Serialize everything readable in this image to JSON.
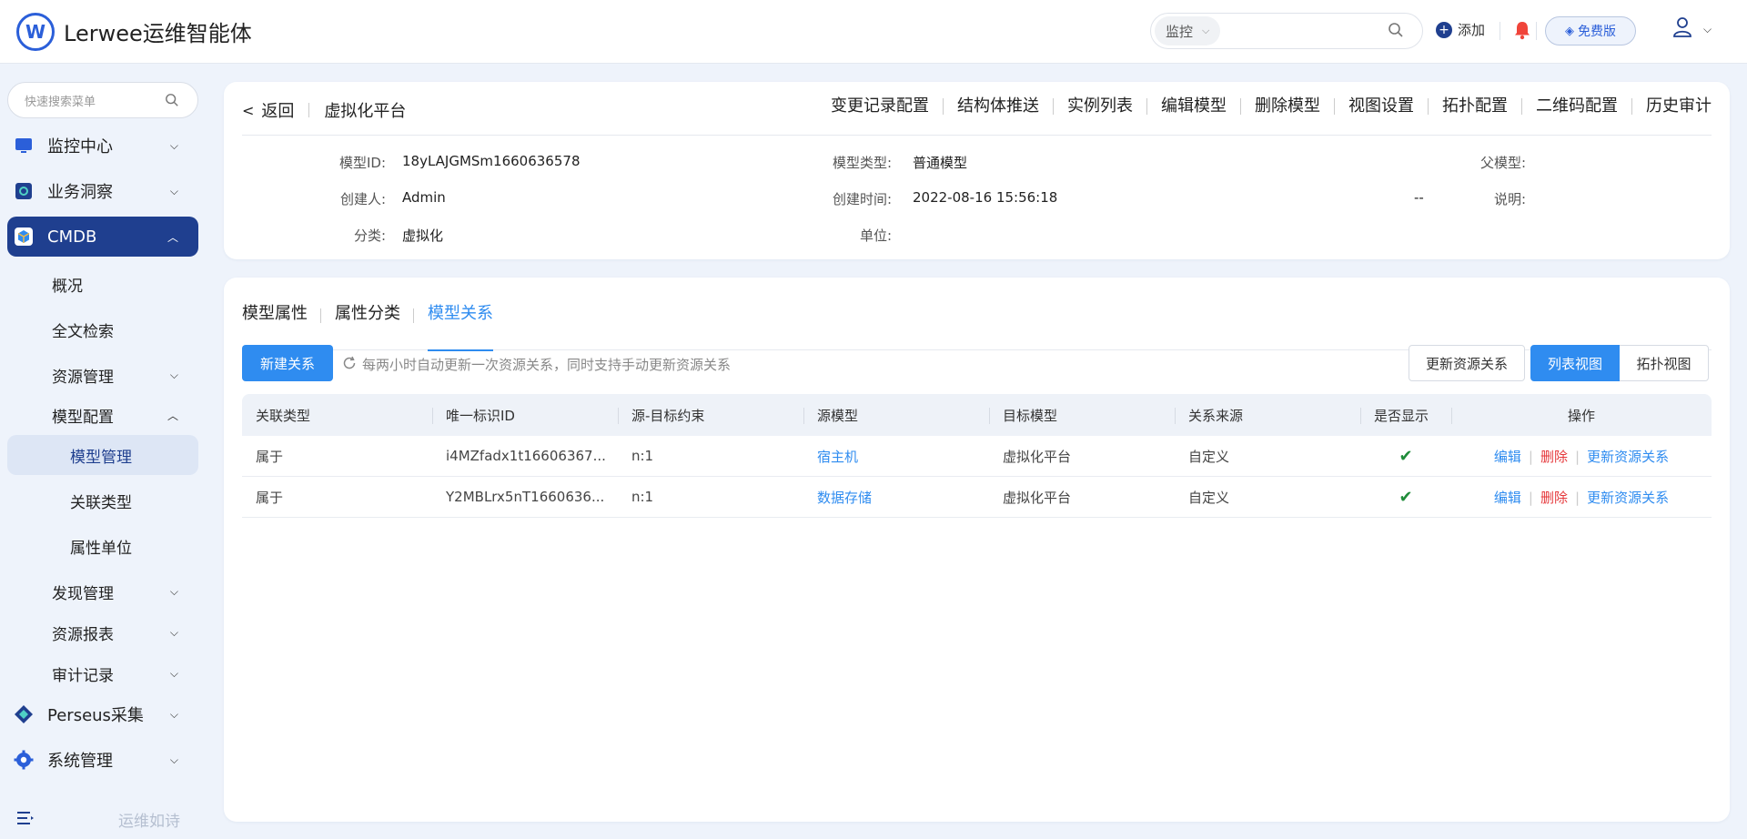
{
  "app": {
    "title": "Lerwee运维智能体",
    "logo_letter": "W"
  },
  "header": {
    "search_scope": "监控",
    "add_label": "添加",
    "free_label": "免费版",
    "icons": [
      "search-icon",
      "plus-circle-icon",
      "bell-icon",
      "diamond-icon",
      "user-icon",
      "chevron-down-icon"
    ]
  },
  "sidebar": {
    "search_placeholder": "快速搜索菜单",
    "items": [
      {
        "label": "监控中心",
        "icon": "monitor-icon"
      },
      {
        "label": "业务洞察",
        "icon": "insight-icon"
      },
      {
        "label": "CMDB",
        "icon": "cube-icon",
        "active": true
      },
      {
        "label": "Perseus采集",
        "icon": "perseus-icon"
      },
      {
        "label": "系统管理",
        "icon": "gear-icon"
      }
    ],
    "sub_items": [
      {
        "label": "概况"
      },
      {
        "label": "全文检索"
      },
      {
        "label": "资源管理"
      },
      {
        "label": "模型配置"
      },
      {
        "label": "模型管理",
        "selected": true
      },
      {
        "label": "关联类型"
      },
      {
        "label": "属性单位"
      },
      {
        "label": "发现管理"
      },
      {
        "label": "资源报表"
      },
      {
        "label": "审计记录"
      }
    ],
    "footer_slogan": "运维如诗"
  },
  "detail": {
    "back_label": "返回",
    "model_name": "虚拟化平台",
    "actions": [
      "变更记录配置",
      "结构体推送",
      "实例列表",
      "编辑模型",
      "删除模型",
      "视图设置",
      "拓扑配置",
      "二维码配置",
      "历史审计"
    ],
    "fields": {
      "model_id_label": "模型ID:",
      "model_id": "18yLAJGMSm1660636578",
      "model_type_label": "模型类型:",
      "model_type": "普通模型",
      "parent_label": "父模型:",
      "parent": "",
      "creator_label": "创建人:",
      "creator": "Admin",
      "created_label": "创建时间:",
      "created": "2022-08-16 15:56:18",
      "desc_label": "说明:",
      "desc": "--",
      "category_label": "分类:",
      "category": "虚拟化",
      "unit_label": "单位:",
      "unit": ""
    }
  },
  "relations": {
    "tabs": [
      "模型属性",
      "属性分类",
      "模型关系"
    ],
    "active_tab": 2,
    "new_button": "新建关系",
    "tip": "每两小时自动更新一次资源关系，同时支持手动更新资源关系",
    "update_button": "更新资源关系",
    "view_list": "列表视图",
    "view_topo": "拓扑视图",
    "columns": [
      "关联类型",
      "唯一标识ID",
      "源-目标约束",
      "源模型",
      "目标模型",
      "关系来源",
      "是否显示",
      "操作"
    ],
    "rows": [
      {
        "type": "属于",
        "uid": "i4MZfadx1t16606367...",
        "constraint": "n:1",
        "source": "宿主机",
        "target": "虚拟化平台",
        "origin": "自定义",
        "shown": true
      },
      {
        "type": "属于",
        "uid": "Y2MBLrx5nT1660636...",
        "constraint": "n:1",
        "source": "数据存储",
        "target": "虚拟化平台",
        "origin": "自定义",
        "shown": true
      }
    ],
    "ops": {
      "edit": "编辑",
      "delete": "删除",
      "update": "更新资源关系"
    },
    "check_mark": "✔"
  },
  "colors": {
    "brand": "#1f3f8f",
    "primary": "#2f8cf0",
    "danger": "#e5383b",
    "success": "#1f8c3a"
  }
}
